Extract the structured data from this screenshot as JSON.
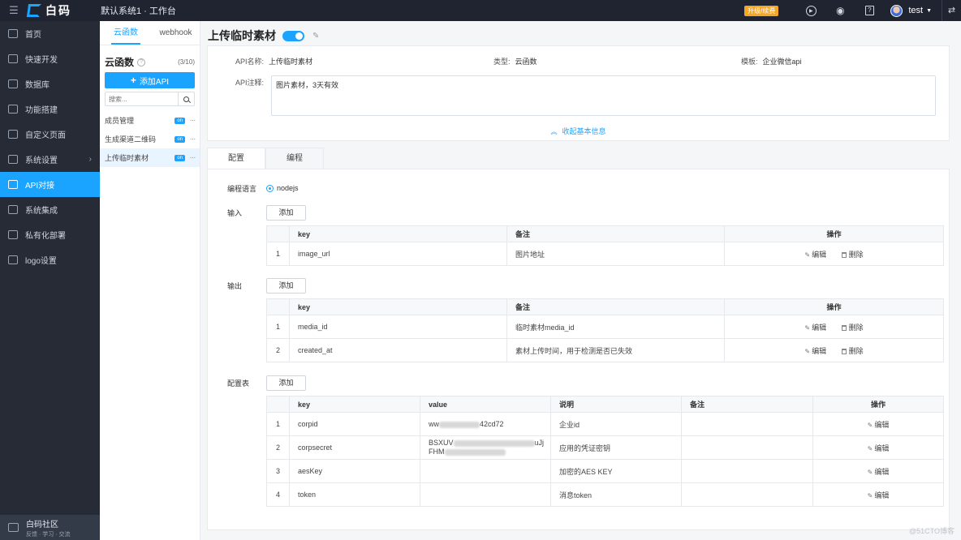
{
  "topbar": {
    "menu_icon": "menu-icon",
    "logo_text": "白码",
    "breadcrumb": "默认系统1 · 工作台",
    "upgrade_label": "升级/续费",
    "user_name": "test"
  },
  "nav": {
    "items": [
      {
        "label": "首页",
        "icon": "home-icon"
      },
      {
        "label": "快速开发",
        "icon": "cube-icon"
      },
      {
        "label": "数据库",
        "icon": "database-icon"
      },
      {
        "label": "功能搭建",
        "icon": "build-icon"
      },
      {
        "label": "自定义页面",
        "icon": "page-icon"
      },
      {
        "label": "系统设置",
        "icon": "settings-icon"
      },
      {
        "label": "API对接",
        "icon": "api-icon"
      },
      {
        "label": "系统集成",
        "icon": "integration-icon"
      },
      {
        "label": "私有化部署",
        "icon": "deploy-icon"
      },
      {
        "label": "logo设置",
        "icon": "logo-icon"
      }
    ],
    "active_index": 6,
    "footer_title": "白码社区",
    "footer_sub": "反馈 · 学习 · 交流"
  },
  "sub": {
    "tabs": [
      "云函数",
      "webhook"
    ],
    "title": "云函数",
    "count": "(3/10)",
    "add_label": "添加API",
    "search_placeholder": "搜索...",
    "items": [
      {
        "label": "成员管理",
        "badge": "on"
      },
      {
        "label": "生成渠道二维码",
        "badge": "on"
      },
      {
        "label": "上传临时素材",
        "badge": "on"
      }
    ]
  },
  "main": {
    "title": "上传临时素材",
    "info": {
      "name_label": "API名称:",
      "name_value": "上传临时素材",
      "type_label": "类型:",
      "type_value": "云函数",
      "template_label": "模板:",
      "template_value": "企业微信api",
      "note_label": "API注释:",
      "note_value": "图片素材，3天有效",
      "collapse_label": "收起基本信息"
    },
    "tabs": [
      "配置",
      "编程"
    ],
    "lang_label": "编程语言",
    "lang_value": "nodejs",
    "add_label": "添加",
    "edit_label": "编辑",
    "delete_label": "删除",
    "input": {
      "label": "输入",
      "headers": [
        "key",
        "备注",
        "操作"
      ],
      "rows": [
        {
          "idx": "1",
          "key": "image_url",
          "note": "图片地址"
        }
      ]
    },
    "output": {
      "label": "输出",
      "headers": [
        "key",
        "备注",
        "操作"
      ],
      "rows": [
        {
          "idx": "1",
          "key": "media_id",
          "note": "临时素材media_id"
        },
        {
          "idx": "2",
          "key": "created_at",
          "note": "素材上传时间，用于检测是否已失效"
        }
      ]
    },
    "configtable": {
      "label": "配置表",
      "headers": [
        "key",
        "value",
        "说明",
        "备注",
        "操作"
      ],
      "rows": [
        {
          "idx": "1",
          "key": "corpid",
          "value_prefix": "ww",
          "value_suffix": "42cd72",
          "desc": "企业id",
          "note": ""
        },
        {
          "idx": "2",
          "key": "corpsecret",
          "value_line1_prefix": "BSXUV",
          "value_line1_suffix": "uJj",
          "value_line2_prefix": "FHM",
          "desc": "应用的凭证密钥",
          "note": ""
        },
        {
          "idx": "3",
          "key": "aesKey",
          "desc": "加密的AES KEY",
          "note": ""
        },
        {
          "idx": "4",
          "key": "token",
          "desc": "消息token",
          "note": ""
        }
      ]
    }
  },
  "watermark": "@51CTO博客"
}
